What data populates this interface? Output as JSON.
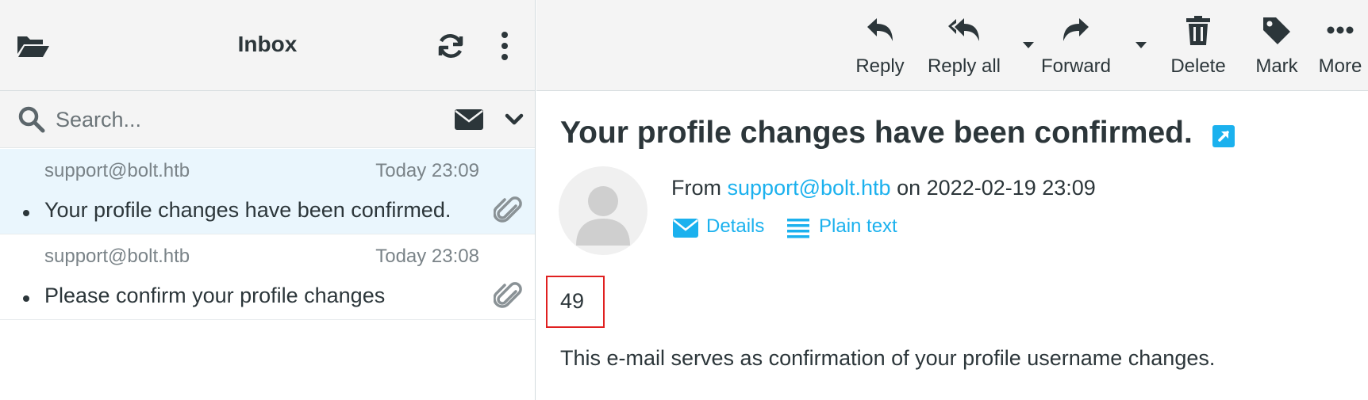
{
  "mailbox": {
    "title": "Inbox",
    "search_placeholder": "Search..."
  },
  "messages": [
    {
      "from": "support@bolt.htb",
      "date": "Today 23:09",
      "subject": "Your profile changes have been confirmed.",
      "selected": true
    },
    {
      "from": "support@bolt.htb",
      "date": "Today 23:08",
      "subject": "Please confirm your profile changes",
      "selected": false
    }
  ],
  "toolbar": {
    "reply": "Reply",
    "reply_all": "Reply all",
    "forward": "Forward",
    "delete": "Delete",
    "mark": "Mark",
    "more": "More"
  },
  "message": {
    "subject": "Your profile changes have been confirmed.",
    "from_prefix": "From",
    "from_address": "support@bolt.htb",
    "on_word": "on",
    "date": "2022-02-19 23:09",
    "details_label": "Details",
    "plain_text_label": "Plain text",
    "code": "49",
    "body": "This e-mail serves as confirmation of your profile username changes."
  },
  "colors": {
    "accent": "#1bb1ee",
    "highlight_box": "#e02020",
    "selected_row": "#eaf6fd",
    "text": "#2c363a"
  }
}
